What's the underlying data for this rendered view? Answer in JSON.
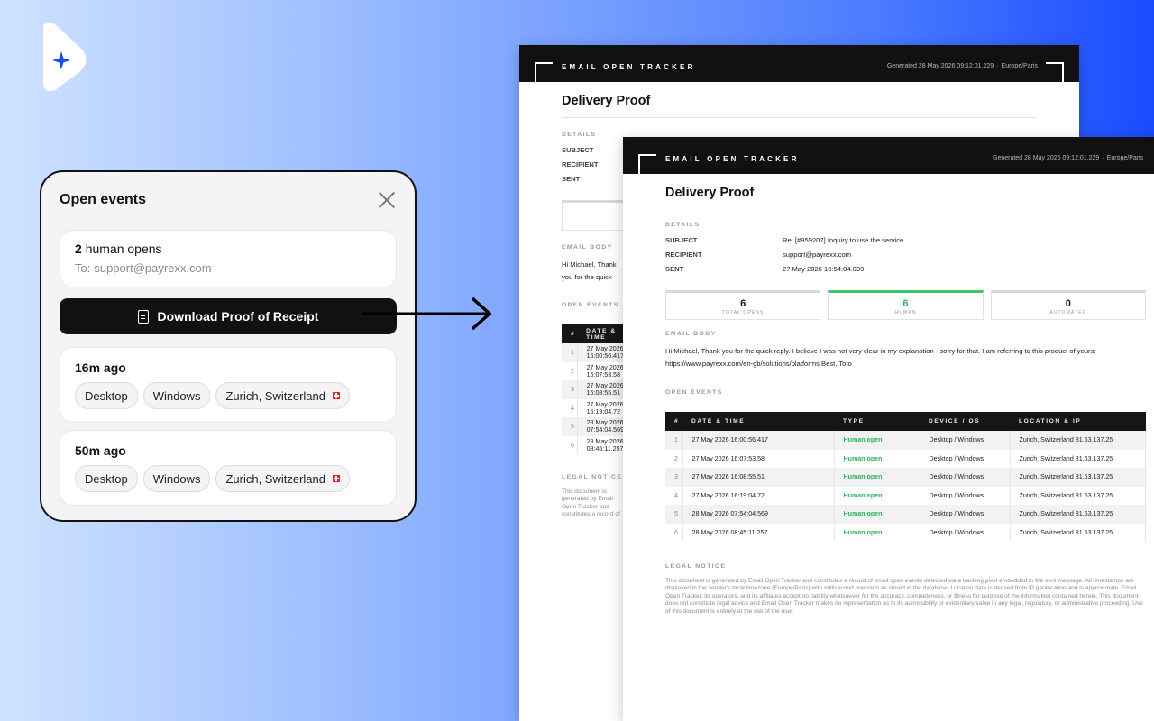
{
  "panel": {
    "title": "Open events",
    "summary": {
      "count": "2",
      "label": "human opens",
      "to_label": "To:",
      "to_email": "support@payrexx.com"
    },
    "download_label": "Download Proof of Receipt",
    "events": [
      {
        "time": "16m ago",
        "device": "Desktop",
        "os": "Windows",
        "location": "Zurich, Switzerland"
      },
      {
        "time": "50m ago",
        "device": "Desktop",
        "os": "Windows",
        "location": "Zurich, Switzerland"
      }
    ]
  },
  "report": {
    "brand": "EMAIL OPEN TRACKER",
    "generated": "Generated 28 May 2026 09:12:01.229",
    "timezone": "Europe/Paris",
    "title": "Delivery Proof",
    "details_heading": "DETAILS",
    "details": [
      {
        "key": "SUBJECT",
        "value": "Re: [#959207] Inquiry to use the service"
      },
      {
        "key": "RECIPIENT",
        "value": "support@payrexx.com"
      },
      {
        "key": "SENT",
        "value": "27 May 2026  15:54:04.039"
      }
    ],
    "stats": [
      {
        "value": "6",
        "label": "TOTAL OPENS"
      },
      {
        "value": "6",
        "label": "HUMAN"
      },
      {
        "value": "0",
        "label": "AUTOMATED"
      }
    ],
    "body_heading": "EMAIL BODY",
    "body_text": "Hi Michael, Thank you for the quick reply. I believe I was not very clear in my explanation - sorry for that. I am referring to this product of yours: https://www.payrexx.com/en-gb/solutions/platforms Best, Toto",
    "events_heading": "OPEN EVENTS",
    "columns": [
      "#",
      "DATE & TIME",
      "TYPE",
      "DEVICE / OS",
      "LOCATION & IP"
    ],
    "rows": [
      {
        "n": "1",
        "date": "27 May 2026  16:00:56.417",
        "type": "Human open",
        "device": "Desktop / Windows",
        "location": "Zurich, Switzerland  81.63.137.25"
      },
      {
        "n": "2",
        "date": "27 May 2026  16:07:53.58",
        "type": "Human open",
        "device": "Desktop / Windows",
        "location": "Zurich, Switzerland  81.63.137.25"
      },
      {
        "n": "3",
        "date": "27 May 2026  16:08:55.51",
        "type": "Human open",
        "device": "Desktop / Windows",
        "location": "Zurich, Switzerland  81.63.137.25"
      },
      {
        "n": "4",
        "date": "27 May 2026  16:19:04.72",
        "type": "Human open",
        "device": "Desktop / Windows",
        "location": "Zurich, Switzerland  81.63.137.25"
      },
      {
        "n": "5",
        "date": "28 May 2026  07:54:04.569",
        "type": "Human open",
        "device": "Desktop / Windows",
        "location": "Zurich, Switzerland  81.63.137.25"
      },
      {
        "n": "6",
        "date": "28 May 2026  08:45:11.257",
        "type": "Human open",
        "device": "Desktop / Windows",
        "location": "Zurich, Switzerland  81.63.137.25"
      }
    ],
    "legal_heading": "LEGAL NOTICE",
    "legal_text": "This document is generated by Email Open Tracker and constitutes a record of email open events detected via a tracking pixel embedded in the sent message. All timestamps are displayed in the sender's local timezone (Europe/Paris) with millisecond precision as stored in the database. Location data is derived from IP geolocation and is approximate. Email Open Tracker, its operators, and its affiliates accept no liability whatsoever for the accuracy, completeness, or fitness for purpose of the information contained herein. This document does not constitute legal advice and Email Open Tracker makes no representation as to its admissibility or evidentiary value in any legal, regulatory, or administrative proceeding. Use of this document is entirely at the risk of the user."
  },
  "colors": {
    "human_green": "#2bb35a",
    "accent_blue": "#1a4cff",
    "button_black": "#111111"
  }
}
